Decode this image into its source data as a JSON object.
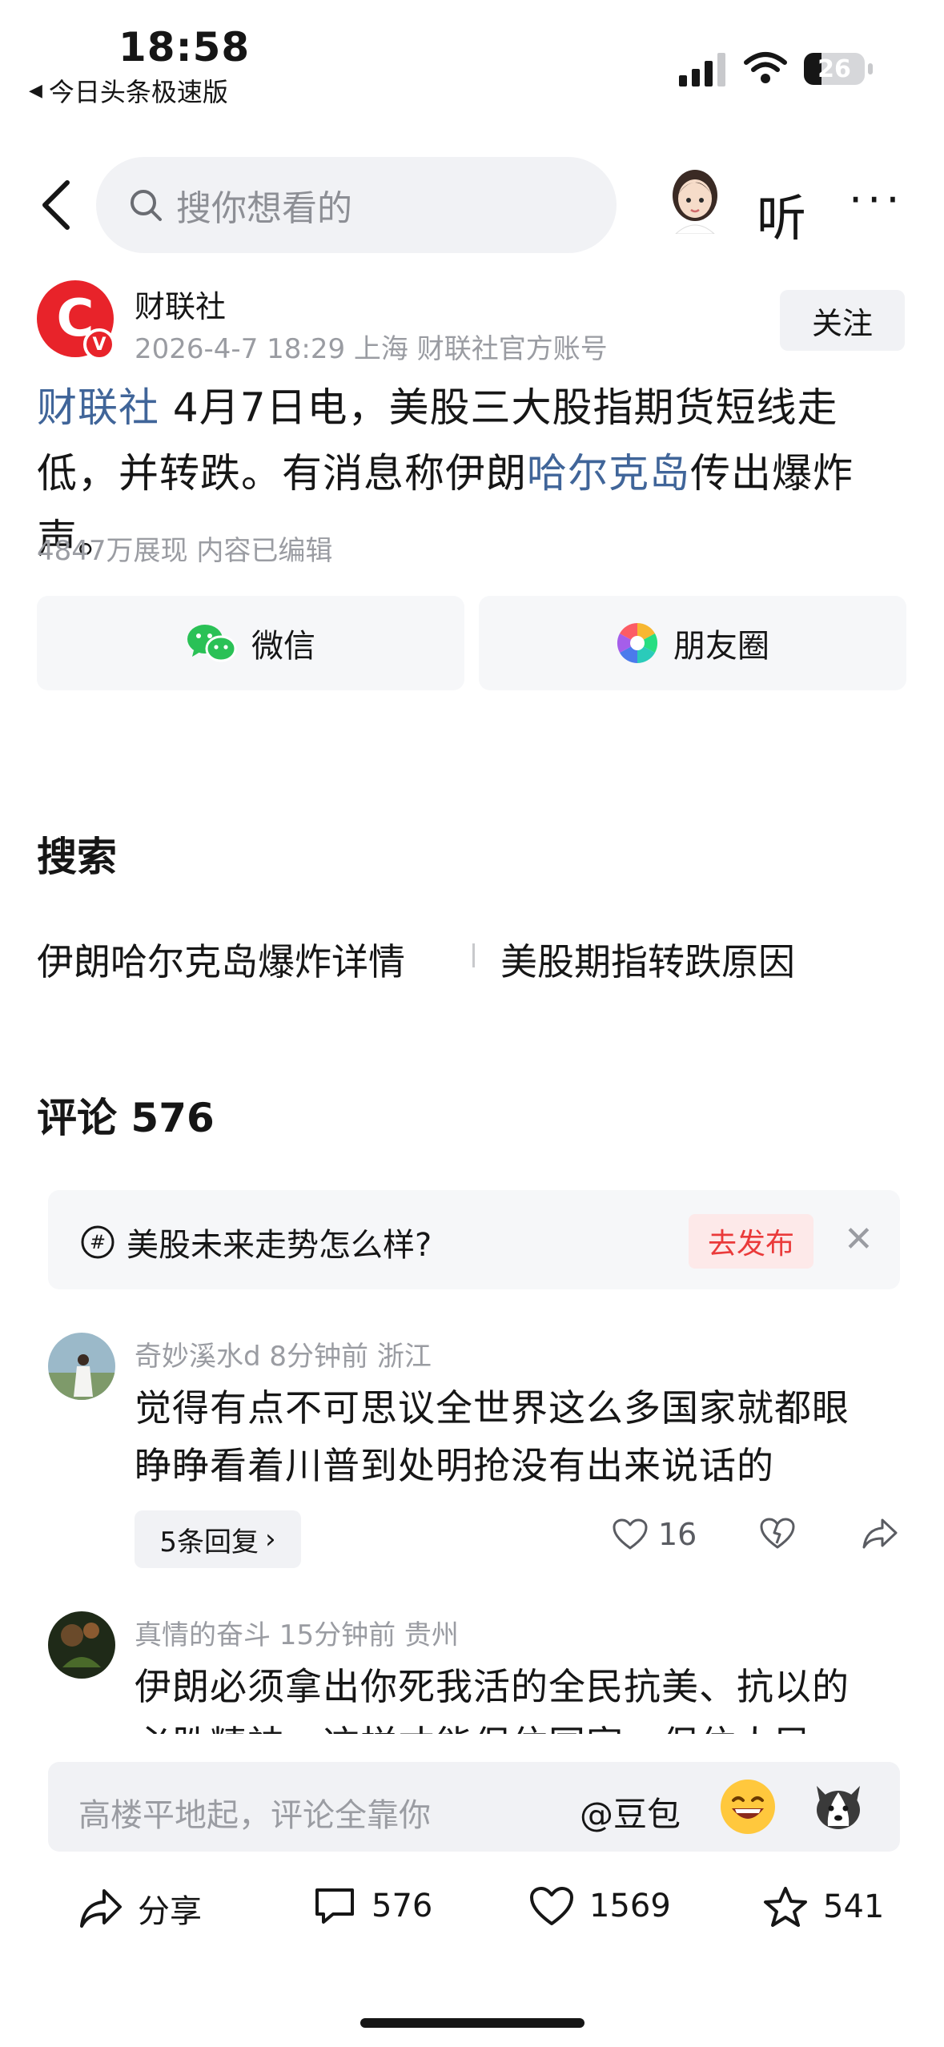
{
  "status_bar": {
    "time": "18:58",
    "back_app": "今日头条极速版",
    "battery": "26"
  },
  "header": {
    "search_placeholder": "搜你想看的",
    "listen_label": "听"
  },
  "author": {
    "name": "财联社",
    "logo_letter": "C",
    "verified_badge": "V",
    "meta": "2026-4-7 18:29  上海  财联社官方账号",
    "follow_label": "关注"
  },
  "article": {
    "source_link": "财联社",
    "text_part1": " 4月7日电，美股三大股指期货短线走低，并转跌。有消息称伊朗",
    "place_link": "哈尔克岛",
    "text_part2": "传出爆炸声。",
    "stats": "4847万展现   内容已编辑"
  },
  "share": {
    "wechat": "微信",
    "moments": "朋友圈"
  },
  "search_section": {
    "title": "搜索",
    "links": [
      "伊朗哈尔克岛爆炸详情",
      "美股期指转跌原因"
    ]
  },
  "comments_section": {
    "title": "评论 576",
    "hint_text": "美股未来走势怎么样?",
    "publish_label": "去发布"
  },
  "comments": [
    {
      "meta": "奇妙溪水d  8分钟前  浙江",
      "text_line1": "觉得有点不可思议全世界这么多国家就都眼",
      "text_line2": "睁睁看着川普到处明抢没有出来说话的",
      "replies_label": "5条回复",
      "likes": "16"
    },
    {
      "meta": "真情的奋斗  15分钟前  贵州",
      "text_line1": "伊朗必须拿出你死我活的全民抗美、抗以的",
      "text_line2": "必胜精神，这样才能保住国家，保住人民"
    }
  ],
  "bottom": {
    "input_placeholder": "高楼平地起，评论全靠你",
    "mention": "@豆包",
    "share_label": "分享",
    "comments_count": "576",
    "likes_count": "1569",
    "favorites_count": "541"
  },
  "colors": {
    "link": "#406599",
    "brand_red": "#e8232a",
    "publish_red": "#ea3a3a"
  }
}
